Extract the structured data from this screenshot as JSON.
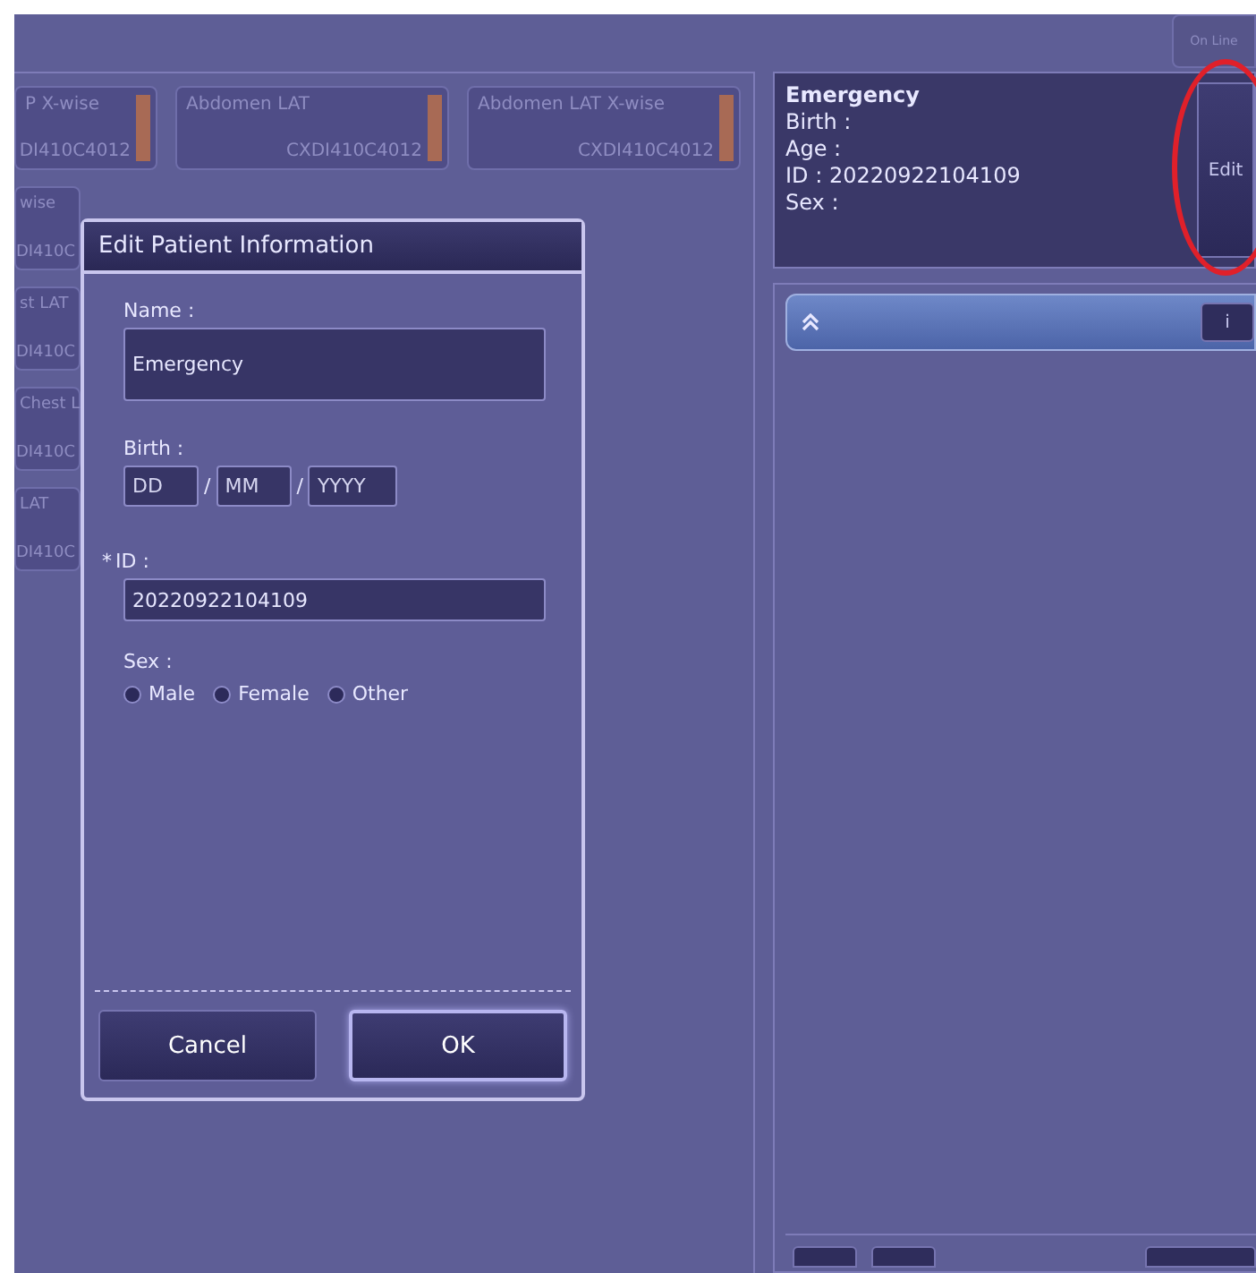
{
  "status_button": "On Line",
  "exam_tiles": [
    {
      "name": "P X-wise",
      "device": "DI410C4012"
    },
    {
      "name": "Abdomen LAT",
      "device": "CXDI410C4012"
    },
    {
      "name": "Abdomen LAT X-wise",
      "device": "CXDI410C4012"
    },
    {
      "name": "wise",
      "device": "DI410C"
    },
    {
      "name": "st LAT",
      "device": "DI410C"
    },
    {
      "name": "Chest L",
      "device": "DI410C"
    },
    {
      "name": "LAT",
      "device": "DI410C"
    }
  ],
  "patient": {
    "name": "Emergency",
    "lines": [
      "Birth :",
      "Age :",
      "ID : 20220922104109",
      "Sex :"
    ],
    "edit_button": "Edit"
  },
  "study_bar": {
    "info_button": "i"
  },
  "dialog": {
    "title": "Edit Patient Information",
    "name_label": "Name :",
    "name_value": "Emergency",
    "birth_label": "Birth :",
    "birth_fields": [
      {
        "placeholder": "DD"
      },
      {
        "placeholder": "MM"
      },
      {
        "placeholder": "YYYY"
      }
    ],
    "birth_separators": [
      "/",
      "/"
    ],
    "required_mark": "*",
    "id_label": "ID :",
    "id_value": "20220922104109",
    "sex_label": "Sex :",
    "sex_options": [
      {
        "label": "Male",
        "selected": false
      },
      {
        "label": "Female",
        "selected": false
      },
      {
        "label": "Other",
        "selected": false
      }
    ],
    "buttons": [
      {
        "label": "Cancel",
        "default": false
      },
      {
        "label": "OK",
        "default": true
      }
    ]
  }
}
